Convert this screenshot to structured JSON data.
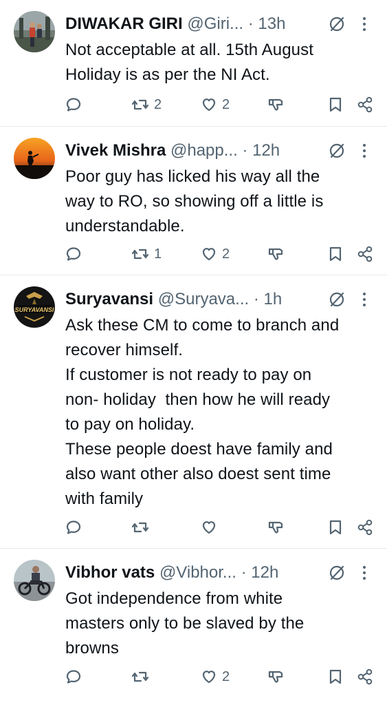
{
  "tweets": [
    {
      "name": "DIWAKAR GIRI",
      "handle": "@Giri...",
      "dot": "·",
      "time": "13h",
      "text": "Not acceptable at all. 15th August\nHoliday is as per the NI Act.",
      "reply_count": "",
      "retweet_count": "2",
      "like_count": "2",
      "avatar_icon": "avatar-photo-person-outdoors"
    },
    {
      "name": "Vivek Mishra",
      "handle": "@happ...",
      "dot": "·",
      "time": "12h",
      "text": "Poor guy has licked his way all the\nway to RO, so showing off a little is\nunderstandable.",
      "reply_count": "",
      "retweet_count": "1",
      "like_count": "2",
      "avatar_icon": "avatar-photo-sunset-silhouette"
    },
    {
      "name": "Suryavansi",
      "handle": "@Suryava...",
      "dot": "·",
      "time": "1h",
      "text": "Ask these CM to come to branch and\nrecover himself.\nIf customer is not ready to pay on\nnon- holiday  then how he will ready\nto pay on holiday.\nThese people doest have family and\nalso want other also doest sent time\nwith family",
      "reply_count": "",
      "retweet_count": "",
      "like_count": "",
      "avatar_icon": "avatar-suryavansi-logo",
      "avatar_text": "SURYAVANSI"
    },
    {
      "name": "Vibhor vats",
      "handle": "@Vibhor...",
      "dot": "·",
      "time": "12h",
      "text": "Got independence from white\nmasters only to be slaved by the\nbrowns",
      "reply_count": "",
      "retweet_count": "",
      "like_count": "2",
      "avatar_icon": "avatar-photo-motorcycle-rider"
    }
  ],
  "colors": {
    "text": "#0f1419",
    "secondary": "#536471",
    "divider": "#e6e9ec"
  }
}
